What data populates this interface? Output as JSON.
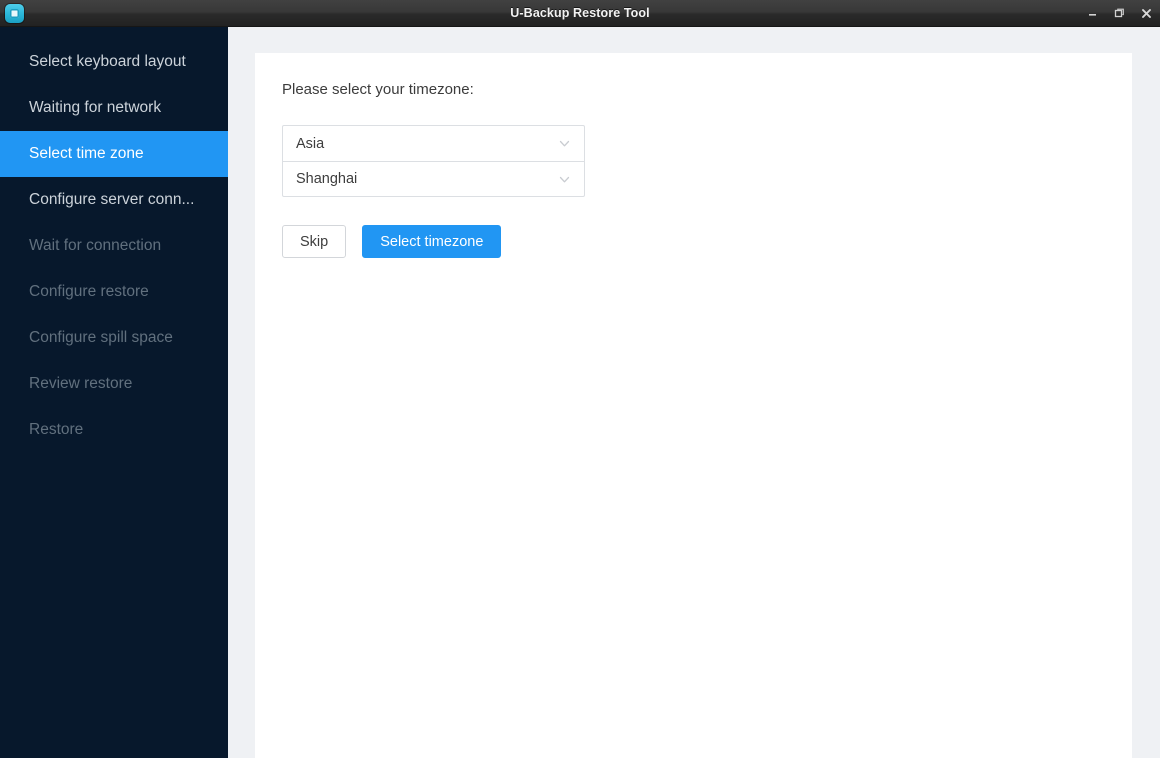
{
  "window": {
    "title": "U-Backup Restore Tool",
    "app_icon": "backup-app-icon",
    "controls": {
      "minimize": "minimize-icon",
      "maximize": "maximize-restore-icon",
      "close": "close-icon"
    }
  },
  "sidebar": {
    "items": [
      {
        "label": "Select keyboard layout",
        "state": "done"
      },
      {
        "label": "Waiting for network",
        "state": "done"
      },
      {
        "label": "Select time zone",
        "state": "active"
      },
      {
        "label": "Configure server conn...",
        "state": "done"
      },
      {
        "label": "Wait for connection",
        "state": "disabled"
      },
      {
        "label": "Configure restore",
        "state": "disabled"
      },
      {
        "label": "Configure spill space",
        "state": "disabled"
      },
      {
        "label": "Review restore",
        "state": "disabled"
      },
      {
        "label": "Restore",
        "state": "disabled"
      }
    ]
  },
  "main": {
    "prompt": "Please select your timezone:",
    "region_select": {
      "value": "Asia",
      "icon": "chevron-down-icon"
    },
    "city_select": {
      "value": "Shanghai",
      "icon": "chevron-down-icon"
    },
    "buttons": {
      "skip": "Skip",
      "submit": "Select timezone"
    }
  },
  "colors": {
    "accent": "#2196f3",
    "sidebar_bg": "#07182c",
    "page_bg": "#eff1f4",
    "card_bg": "#ffffff",
    "titlebar_bg": "#2f2f2f"
  }
}
